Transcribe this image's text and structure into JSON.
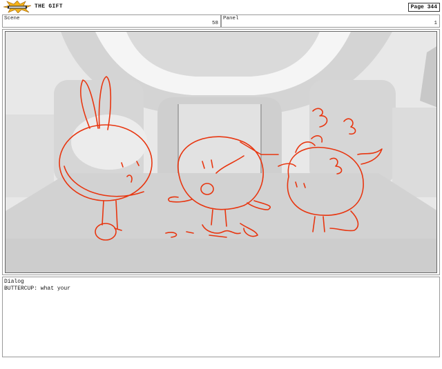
{
  "header": {
    "logo_icon": "explosion-logo-icon",
    "title": "THE GIFT",
    "page_label": "Page 344"
  },
  "meta": {
    "scene_label": "Scene",
    "scene_value": "58",
    "panel_label": "Panel",
    "panel_value": "1"
  },
  "panel": {
    "sketch_color": "#e8350f",
    "background_tones": [
      "#e6e6e6",
      "#d2d2d2",
      "#bdbdbd",
      "#f4f4f4"
    ]
  },
  "dialog": {
    "label": "Dialog",
    "text": "BUTTERCUP: what your"
  }
}
